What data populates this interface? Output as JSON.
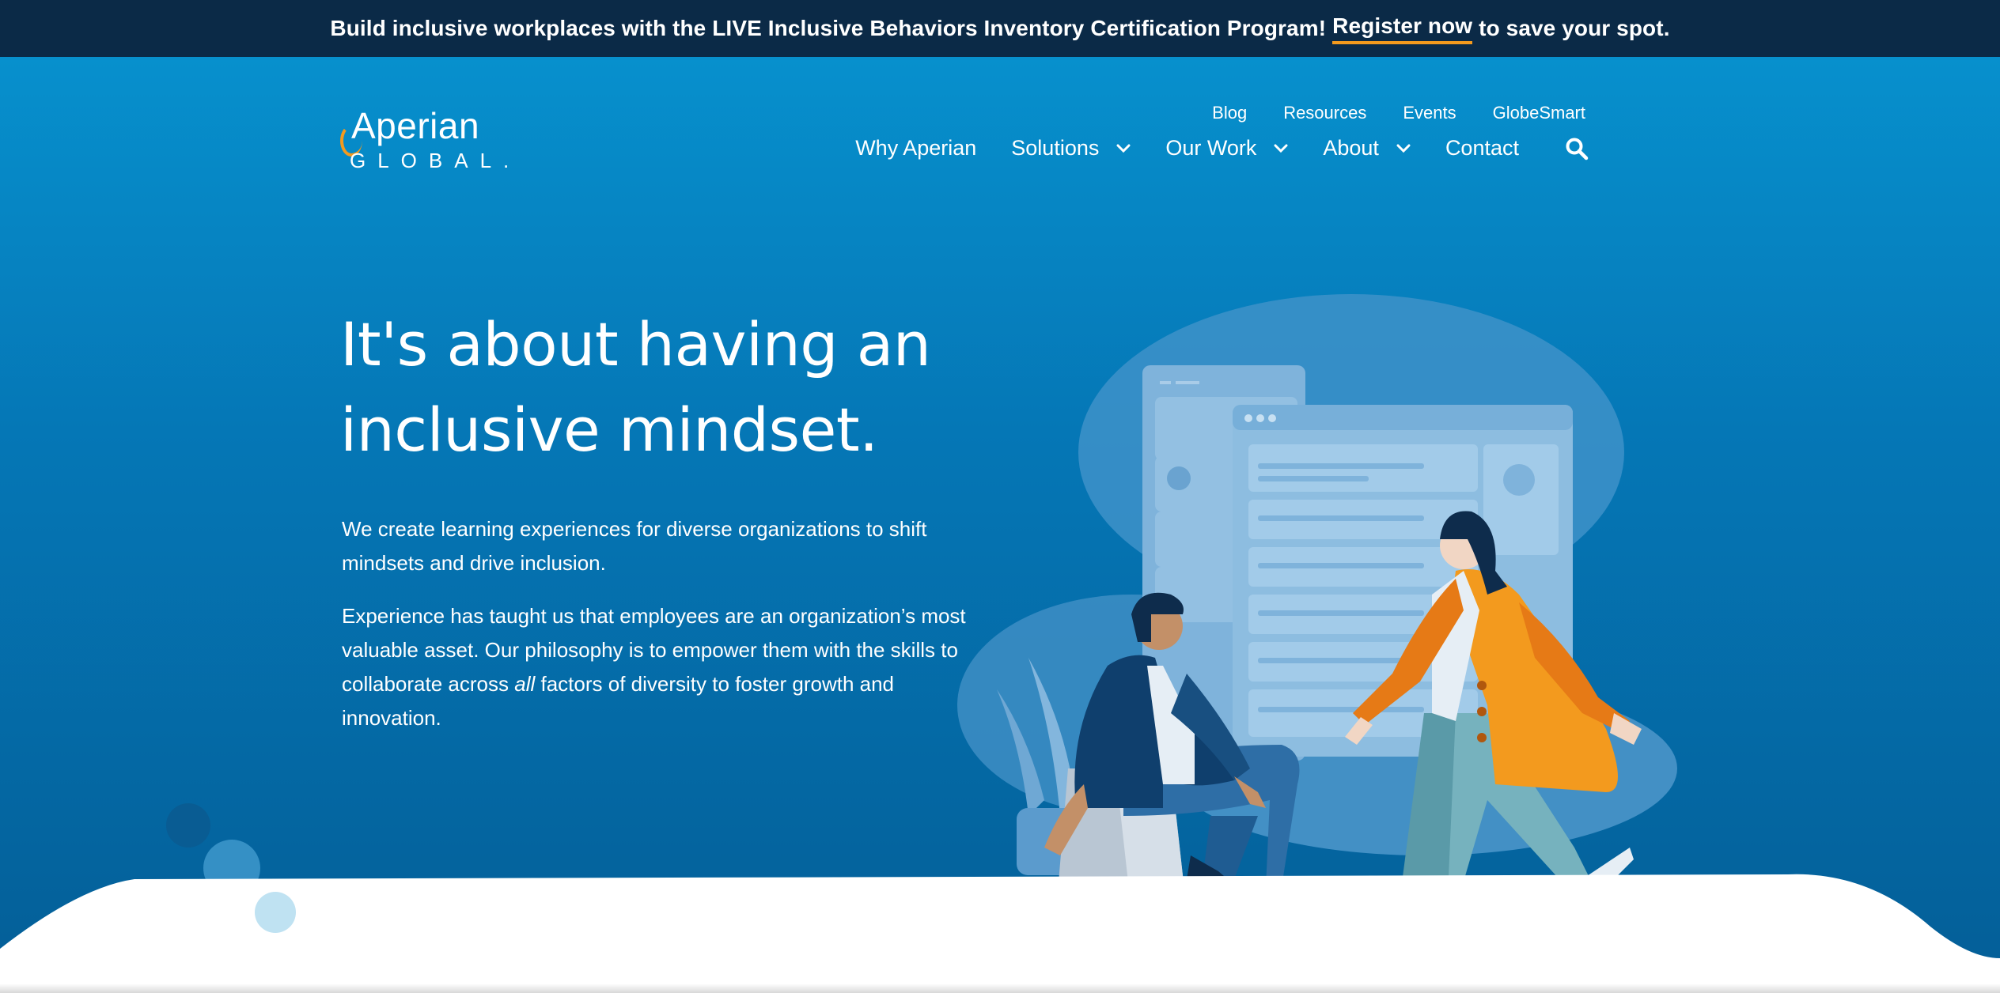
{
  "announcement": {
    "text_before": "Build inclusive workplaces with the LIVE Inclusive Behaviors Inventory Certification Program!",
    "link_label": "Register now",
    "text_after": "to save your spot."
  },
  "brand": {
    "logo_line1": "Aperian",
    "logo_line2": "GLOBAL."
  },
  "utility_nav": [
    "Blog",
    "Resources",
    "Events",
    "GlobeSmart"
  ],
  "main_nav": {
    "why": "Why Aperian",
    "solutions": "Solutions",
    "our_work": "Our Work",
    "about": "About",
    "contact": "Contact"
  },
  "hero": {
    "headline_line1": "It's about having an",
    "headline_line2": "inclusive mindset.",
    "para1": "We create learning experiences for diverse organizations to shift mindsets and drive inclusion.",
    "para2_before": "Experience has taught us that employees are an organization’s most valuable asset. Our philosophy is to empower them with the skills to collaborate across",
    "para2_em": "all",
    "para2_after": "factors of diversity to foster growth and innovation."
  },
  "colors": {
    "announce_bg": "#0b2a47",
    "accent_orange": "#f39a1e",
    "hero_top": "#0790cd",
    "hero_bottom": "#045e97"
  },
  "icons": {
    "search": "search-icon",
    "chevron": "chevron-down-icon"
  }
}
